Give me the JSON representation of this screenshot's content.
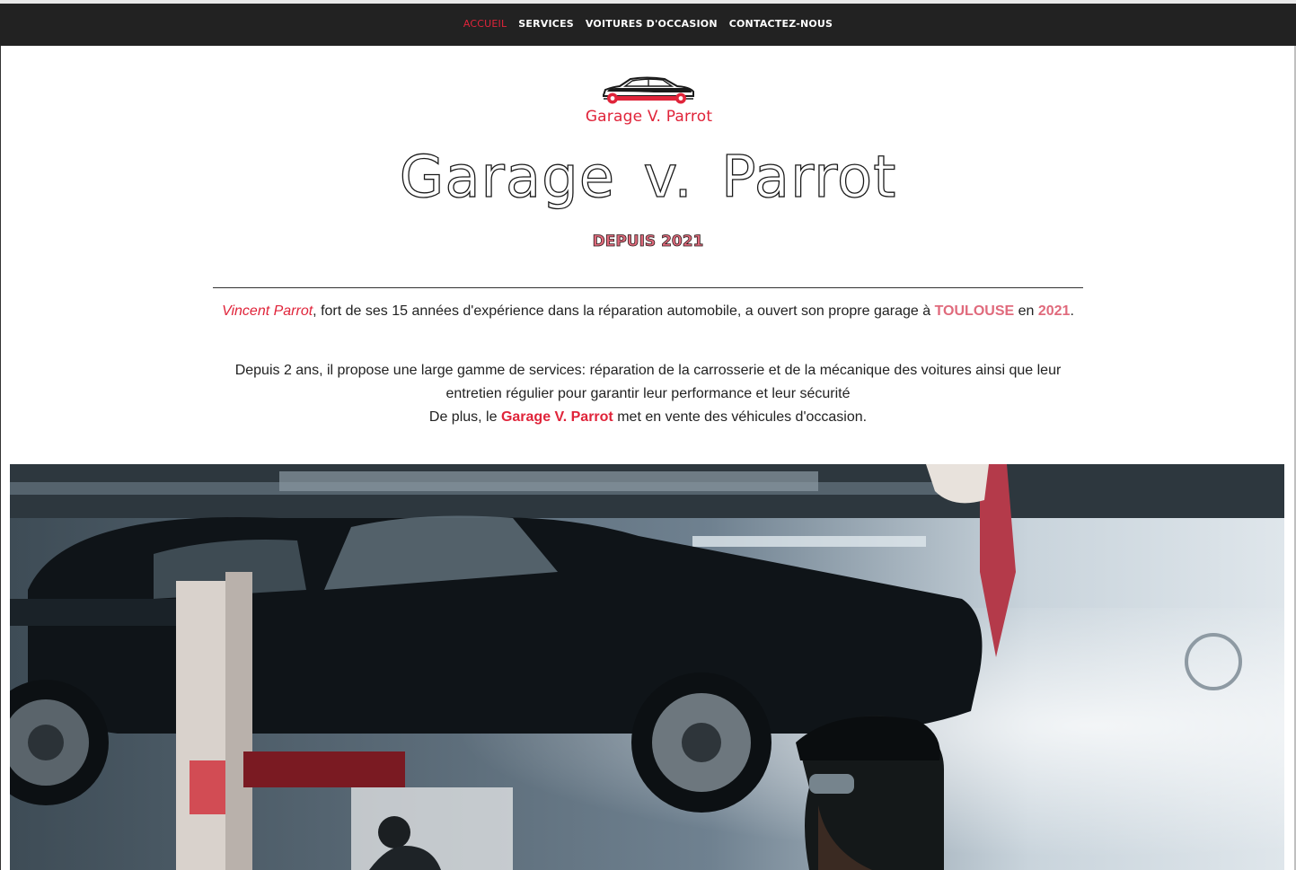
{
  "nav": {
    "items": [
      {
        "label": "ACCUEIL",
        "active": true
      },
      {
        "label": "SERVICES",
        "active": false
      },
      {
        "label": "VOITURES D'OCCASION",
        "active": false
      },
      {
        "label": "CONTACTEZ-NOUS",
        "active": false
      }
    ]
  },
  "logo": {
    "icon": "car-wrench-logo-icon",
    "text": "Garage V. Parrot"
  },
  "hero": {
    "title": "Garage v. Parrot",
    "subtitle": "DEPUIS 2021"
  },
  "intro": {
    "owner": "Vincent Parrot",
    "text_1": ", fort de ses 15 années d'expérience dans la réparation automobile, a ouvert son propre garage à ",
    "city": "TOULOUSE",
    "text_2": " en ",
    "year": "2021",
    "text_3": "."
  },
  "services_paragraph": {
    "line_1": "Depuis 2 ans, il propose une large gamme de services: réparation de la carrosserie et de la mécanique des voitures ainsi que leur entretien régulier pour garantir leur performance et leur sécurité",
    "line_2_start": "De plus, le ",
    "brand": "Garage V. Parrot",
    "line_2_end": " met en vente des véhicules d'occasion."
  },
  "colors": {
    "accent": "#e0243a",
    "highlight_pink": "#e06a7c",
    "navbar_bg": "#222222",
    "text": "#222222"
  },
  "banner_image": {
    "icon": "garage-mechanic-car-lift-photo"
  }
}
